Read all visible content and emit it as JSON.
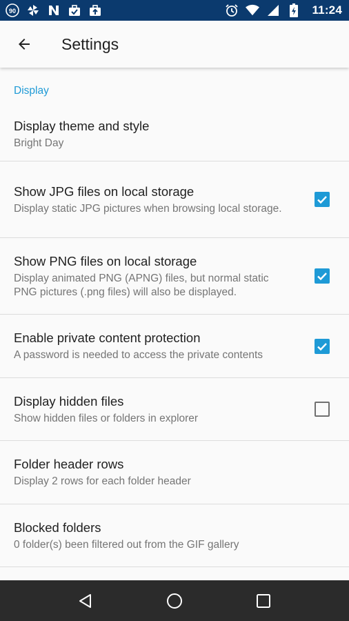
{
  "status_bar": {
    "left_icons": [
      "speed-90-icon",
      "pinwheel-icon",
      "n-logo-icon",
      "briefcase-check-icon",
      "briefcase-upload-icon"
    ],
    "badge_text": "90",
    "right_icons": [
      "alarm-icon",
      "wifi-icon",
      "signal-icon",
      "battery-charging-icon"
    ],
    "time": "11:24"
  },
  "app_bar": {
    "title": "Settings",
    "back_icon": "arrow-back-icon"
  },
  "section": {
    "title": "Display"
  },
  "prefs": [
    {
      "title": "Display theme and style",
      "summary": "Bright Day"
    },
    {
      "title": "Show JPG files on local storage",
      "summary": "Display static JPG pictures when browsing local storage.",
      "checked": true
    },
    {
      "title": "Show PNG files on local storage",
      "summary": "Display animated PNG (APNG) files, but normal static PNG pictures (.png files) will also be displayed.",
      "checked": true
    },
    {
      "title": "Enable private content protection",
      "summary": "A password is needed to access the private contents",
      "checked": true
    },
    {
      "title": "Display hidden files",
      "summary": "Show hidden files or folders in explorer",
      "checked": false
    },
    {
      "title": "Folder header rows",
      "summary": "Display 2 rows for each folder header"
    },
    {
      "title": "Blocked folders",
      "summary": "0 folder(s) been filtered out from the GIF gallery"
    }
  ],
  "nav_bar": {
    "icons": [
      "back-triangle-icon",
      "home-circle-icon",
      "recents-square-icon"
    ]
  },
  "colors": {
    "status_bar": "#0b3a6e",
    "accent": "#1e9ad6",
    "nav_bar": "#2b2b2b"
  }
}
